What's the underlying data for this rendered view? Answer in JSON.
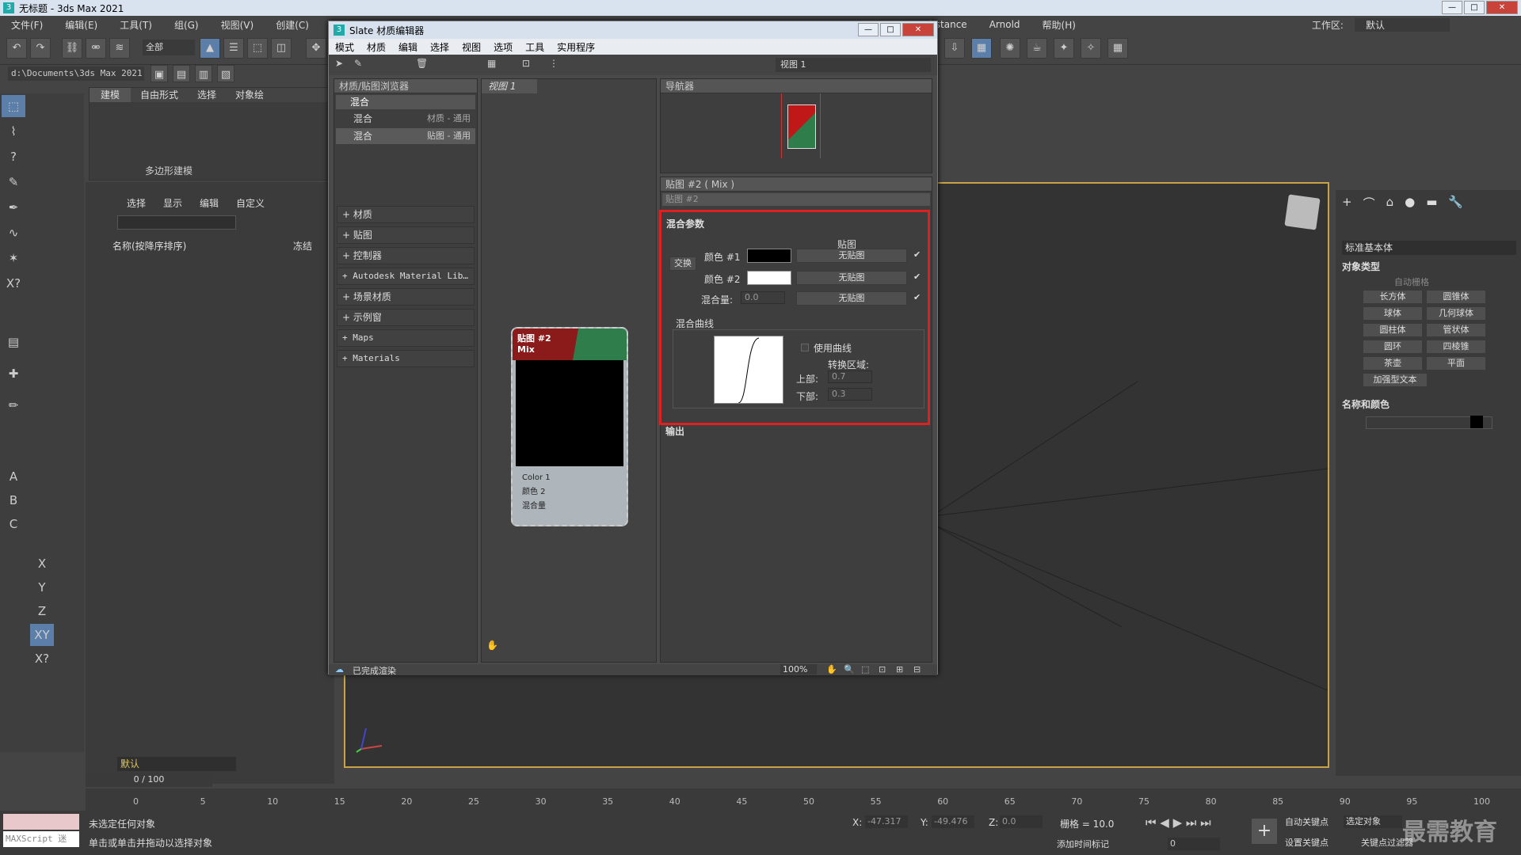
{
  "app": {
    "title": "无标题 - 3ds Max 2021",
    "workspace_label": "工作区:",
    "workspace_value": "默认"
  },
  "menu": [
    "文件(F)",
    "编辑(E)",
    "工具(T)",
    "组(G)",
    "视图(V)",
    "创建(C)"
  ],
  "menu_right": [
    "Substance",
    "Arnold",
    "帮助(H)"
  ],
  "toolbar": {
    "selection_filter": "全部",
    "path": "d:\\Documents\\3ds Max 2021"
  },
  "ribbon": {
    "tabs": [
      "建模",
      "自由形式",
      "选择",
      "对象绘"
    ],
    "group_label": "多边形建模"
  },
  "scene_explorer": {
    "tabs": [
      "选择",
      "显示",
      "编辑",
      "自定义"
    ],
    "column_name": "名称(按降序排序)",
    "column_frozen": "冻结",
    "layer": "默认"
  },
  "slate": {
    "title": "Slate 材质编辑器",
    "menu": [
      "模式",
      "材质",
      "编辑",
      "选择",
      "视图",
      "选项",
      "工具",
      "实用程序"
    ],
    "view_select": "视图 1",
    "browser": {
      "title": "材质/贴图浏览器",
      "search": "混合",
      "results": [
        {
          "name": "混合",
          "type": "材质 - 通用"
        },
        {
          "name": "混合",
          "type": "贴图 - 通用"
        }
      ],
      "rollouts": [
        "+ 材质",
        "+ 贴图",
        "+ 控制器",
        "+ Autodesk Material Lib…",
        "+ 场景材质",
        "+ 示例窗",
        "+ Maps",
        "+ Materials"
      ]
    },
    "view_tab": "视图 1",
    "navigator": "导航器",
    "node": {
      "title": "贴图 #2",
      "subtitle": "Mix",
      "slots": [
        "Color 1",
        "颜色 2",
        "混合量"
      ]
    },
    "param_title": "贴图 #2 ( Mix )",
    "param_name": "贴图 #2",
    "mix_params": {
      "header": "混合参数",
      "map_col": "贴图",
      "swap": "交换",
      "color1_label": "颜色 #1",
      "color2_label": "颜色 #2",
      "amount_label": "混合量:",
      "amount_value": "0.0",
      "no_map": "无贴图",
      "curve_header": "混合曲线",
      "use_curve": "使用曲线",
      "transition": "转换区域:",
      "upper_label": "上部:",
      "upper_value": "0.7",
      "lower_label": "下部:",
      "lower_value": "0.3"
    },
    "output_header": "输出",
    "status": "已完成渲染",
    "zoom": "100%"
  },
  "command_panel": {
    "dropdown": "标准基本体",
    "object_type": "对象类型",
    "autogrid": "自动栅格",
    "buttons": [
      "长方体",
      "圆锥体",
      "球体",
      "几何球体",
      "圆柱体",
      "管状体",
      "圆环",
      "四棱锥",
      "茶壶",
      "平面",
      "加强型文本"
    ],
    "name_color": "名称和颜色"
  },
  "timeline": {
    "frame": "0 / 100",
    "ticks": [
      "0",
      "5",
      "10",
      "15",
      "20",
      "25",
      "30",
      "35",
      "40",
      "45",
      "50",
      "55",
      "60",
      "65",
      "70",
      "75",
      "80",
      "85",
      "90",
      "95",
      "100"
    ]
  },
  "status": {
    "maxscript": "MAXScript 迷",
    "line1": "未选定任何对象",
    "line2": "单击或单击并拖动以选择对象",
    "x_label": "X:",
    "x": "-47.317",
    "y_label": "Y:",
    "y": "-49.476",
    "z_label": "Z:",
    "z": "0.0",
    "grid": "栅格 = 10.0",
    "add_time_tag": "添加时间标记",
    "auto_key": "自动关键点",
    "set_key": "设置关键点",
    "selected": "选定对象",
    "key_filter": "关键点过滤器",
    "frame_field": "0"
  },
  "watermark": "最需教育"
}
